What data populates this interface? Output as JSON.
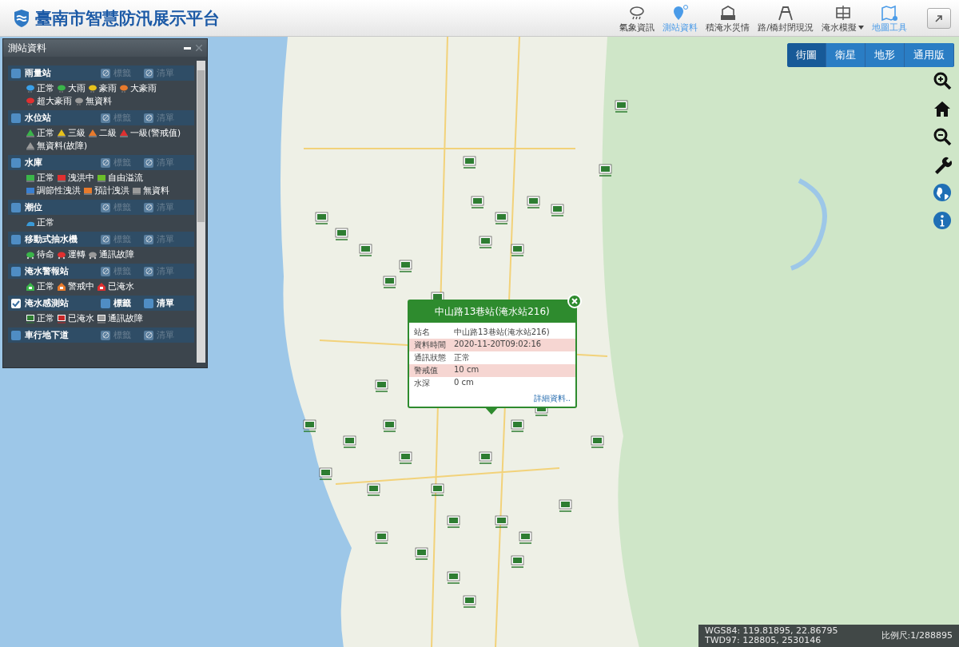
{
  "header": {
    "title": "臺南市智慧防汛展示平台",
    "nav": [
      {
        "kind": "weather",
        "label": "氣象資訊",
        "selected": false
      },
      {
        "kind": "station",
        "label": "測站資料",
        "selected": true
      },
      {
        "kind": "disaster",
        "label": "積淹水災情",
        "selected": false
      },
      {
        "kind": "road",
        "label": "路/橋封閉現況",
        "selected": false
      },
      {
        "kind": "sim",
        "label": "淹水模擬",
        "selected": false,
        "dropdown": true
      },
      {
        "kind": "maptool",
        "label": "地圖工具",
        "selected": true
      }
    ]
  },
  "panel": {
    "title": "測站資料",
    "groups": [
      {
        "kind": "rain",
        "label": "雨量站",
        "checked": false,
        "tag": "標籤",
        "list": "清單",
        "legend": [
          {
            "label": "正常",
            "color": "#3aa0e8"
          },
          {
            "label": "大雨",
            "color": "#3bb54a"
          },
          {
            "label": "豪雨",
            "color": "#e8c21c"
          },
          {
            "label": "大豪雨",
            "color": "#e87a2c"
          },
          {
            "label": "超大豪雨",
            "color": "#e03030"
          },
          {
            "label": "無資料",
            "color": "#9a9a9a"
          }
        ]
      },
      {
        "kind": "level",
        "label": "水位站",
        "checked": false,
        "tag": "標籤",
        "list": "清單",
        "legend": [
          {
            "label": "正常",
            "color": "#3bb54a"
          },
          {
            "label": "三級",
            "color": "#e8c21c"
          },
          {
            "label": "二級",
            "color": "#e87a2c"
          },
          {
            "label": "一級(警戒值)",
            "color": "#e03030"
          },
          {
            "label": "無資料(故障)",
            "color": "#9a9a9a"
          }
        ]
      },
      {
        "kind": "reservoir",
        "label": "水庫",
        "checked": false,
        "tag": "標籤",
        "list": "清單",
        "legend": [
          {
            "label": "正常",
            "color": "#3bb54a"
          },
          {
            "label": "洩洪中",
            "color": "#e03030"
          },
          {
            "label": "自由溢流",
            "color": "#6bbf2a"
          },
          {
            "label": "調節性洩洪",
            "color": "#3a7fd0"
          },
          {
            "label": "預計洩洪",
            "color": "#e87a2c"
          },
          {
            "label": "無資料",
            "color": "#9a9a9a"
          }
        ]
      },
      {
        "kind": "tide",
        "label": "潮位",
        "checked": false,
        "tag": "標籤",
        "list": "清單",
        "legend": [
          {
            "label": "正常",
            "color": "#3a9ad8"
          }
        ]
      },
      {
        "kind": "pump",
        "label": "移動式抽水機",
        "checked": false,
        "tag": "標籤",
        "list": "清單",
        "legend": [
          {
            "label": "待命",
            "color": "#3bb54a"
          },
          {
            "label": "運轉",
            "color": "#e03030"
          },
          {
            "label": "通訊故障",
            "color": "#9a9a9a"
          }
        ]
      },
      {
        "kind": "alarm",
        "label": "淹水警報站",
        "checked": false,
        "tag": "標籤",
        "list": "清單",
        "legend": [
          {
            "label": "正常",
            "color": "#3bb54a"
          },
          {
            "label": "警戒中",
            "color": "#e87a2c"
          },
          {
            "label": "已淹水",
            "color": "#e03030"
          }
        ]
      },
      {
        "kind": "flood",
        "label": "淹水感測站",
        "checked": true,
        "tag": "標籤",
        "list": "清單",
        "legend": [
          {
            "label": "正常",
            "color": "#2f7d32"
          },
          {
            "label": "已淹水",
            "color": "#c62828"
          },
          {
            "label": "通訊故障",
            "color": "#9a9a9a"
          }
        ]
      },
      {
        "label": "車行地下道",
        "checked": false,
        "tag": "標籤",
        "list": "清單"
      }
    ]
  },
  "popup": {
    "title": "中山路13巷站(淹水站216)",
    "rows": [
      {
        "label": "站名",
        "value": "中山路13巷站(淹水站216)"
      },
      {
        "label": "資料時間",
        "value": "2020-11-20T09:02:16"
      },
      {
        "label": "通訊狀態",
        "value": "正常"
      },
      {
        "label": "警戒值",
        "value": "10 cm"
      },
      {
        "label": "水深",
        "value": "0 cm"
      }
    ],
    "link": "詳細資料.."
  },
  "basemaps": [
    {
      "label": "街圖",
      "selected": true
    },
    {
      "label": "衛星",
      "selected": false
    },
    {
      "label": "地形",
      "selected": false
    },
    {
      "label": "通用版",
      "selected": false
    }
  ],
  "tools": [
    {
      "kind": "zoomin"
    },
    {
      "kind": "home"
    },
    {
      "kind": "zoomout"
    },
    {
      "kind": "wrench"
    },
    {
      "kind": "globe"
    },
    {
      "kind": "info"
    }
  ],
  "status": {
    "wgs": "WGS84: 119.81895, 22.86795",
    "twd": "TWD97: 128805, 2530146",
    "scale": "比例尺:1/288895"
  }
}
